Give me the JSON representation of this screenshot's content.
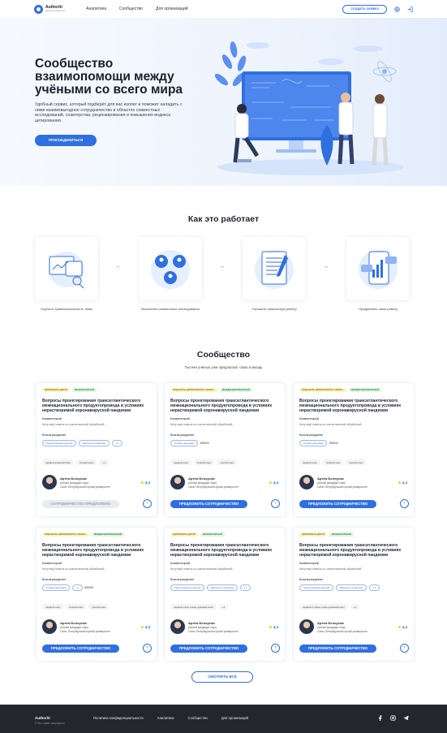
{
  "header": {
    "brand": "Authoriti",
    "brand_sub": "научное сообщество",
    "nav": [
      "Аналитика",
      "Сообщество",
      "Для организаций"
    ],
    "create_button": "СОЗДАТЬ ЗАЯВКУ"
  },
  "hero": {
    "title": "Сообщество взаимопомощи между учёными со всего мира",
    "subtitle": "Удобный сервис, который подберёт для вас коллег и поможет наладить с ними взаимовыгодное сотрудничество в областях совместных исследований, соавторства, рецензирования и повышения индекса цитирования.",
    "join_button": "ПРИСОЕДИНИТЬСЯ"
  },
  "how": {
    "title": "Как это работает",
    "steps": [
      "Оцените привлекательность темы",
      "Выполните совместные исследования",
      "Улучшите написанную работу",
      "Продвигайте свою работу"
    ]
  },
  "community": {
    "title": "Сообщество",
    "subtitle": "Тысячи учёных уже предлагают свою помощь",
    "card_title": "Вопросы проектирования трансатлантического межнационального продуктопровода в условиях нерастворимой коронавирусной пандемии",
    "comment_label": "Комментарий",
    "comment_text": "Могу ещё помочь со статистической обработкой",
    "reward_label": "Вознаграждение",
    "user_name": "Артём Белоусов",
    "user_role": "учёный (кандидат наук)",
    "user_org": "Санкт-Петербургский горный университет",
    "rating": "4,4",
    "offer_button": "ПРЕДЛОЖИТЬ СОТРУДНИЧЕСТВО",
    "disabled_button": "СОТРУДНИЧЕСТВО ПРЕДЛОЖЕНО",
    "cards": [
      {
        "tag1": "ЦИТИРОВАТЬ ДРУГИ",
        "tag2": "МЕЖСЕКТОРНЫЙ",
        "pill1": "Процитировать другим",
        "pill2": "Принять в соавторы",
        "pill3": "+1",
        "money": "",
        "chip1": "первый длинный ключ",
        "chip2": "второй ключ",
        "chip3": "+1",
        "disabled": true
      },
      {
        "tag1": "ПОВЫСИТЬ ЦИТИРУЕМОСТЬ СВОИХ...",
        "tag2": "МЕЖДИСЦИПЛИНАРНЫЙ",
        "pill1": "Оплата деньгами",
        "pill2": "",
        "pill3": "",
        "money": "$25000",
        "chip1": "первый ключ",
        "chip2": "второй ключ",
        "chip3": "третий ключ",
        "disabled": false
      },
      {
        "tag1": "ПОВЫСИТЬ ЦИТИРУЕМОСТЬ СВОИХ...",
        "tag2": "МЕЖДИСЦИПЛИНАРНЫЙ",
        "pill1": "Оплата деньгами",
        "pill2": "",
        "pill3": "",
        "money": "$25000",
        "chip1": "первый ключ",
        "chip2": "второй ключ",
        "chip3": "третий ключ",
        "disabled": false
      },
      {
        "tag1": "ПОВЫСИТЬ ЦИТИРУЕМОСТЬ СВОИХ...",
        "tag2": "МЕЖДИСЦИПЛИНАРНЫЙ",
        "pill1": "Оплата деньгами",
        "pill2": "+1",
        "pill3": "",
        "money": "$25000",
        "chip1": "первый ключ",
        "chip2": "второй ключ",
        "chip3": "третий ключ",
        "disabled": false
      },
      {
        "tag1": "ЦИТИРОВАТЬ ДРУГИ",
        "tag2": "МЕЖСЕКТОРНЫЙ",
        "pill1": "Процитировать другим",
        "pill2": "Принять в соавторы",
        "pill3": "+1",
        "money": "",
        "chip1": "первый очень очень длинный ключ",
        "chip2": "+1",
        "chip3": "",
        "disabled": false
      },
      {
        "tag1": "ЦИТИРОВАТЬ ДРУГИ",
        "tag2": "МЕЖСЕКТОРНЫЙ",
        "pill1": "Процитировать другим",
        "pill2": "Принять в соавторы",
        "pill3": "+1",
        "money": "",
        "chip1": "первый и очень очень длинный ключ",
        "chip2": "+1",
        "chip3": "",
        "disabled": false
      }
    ],
    "see_all": "СМОТРЕТЬ ВСЕ"
  },
  "footer": {
    "brand": "Authoriti",
    "copyright": "© Все права защищены",
    "links": [
      "Политика конфиденциальности",
      "Аналитика",
      "Сообщество",
      "Для организаций"
    ]
  },
  "colors": {
    "accent": "#2f6fe0",
    "footer_bg": "#23262c"
  }
}
